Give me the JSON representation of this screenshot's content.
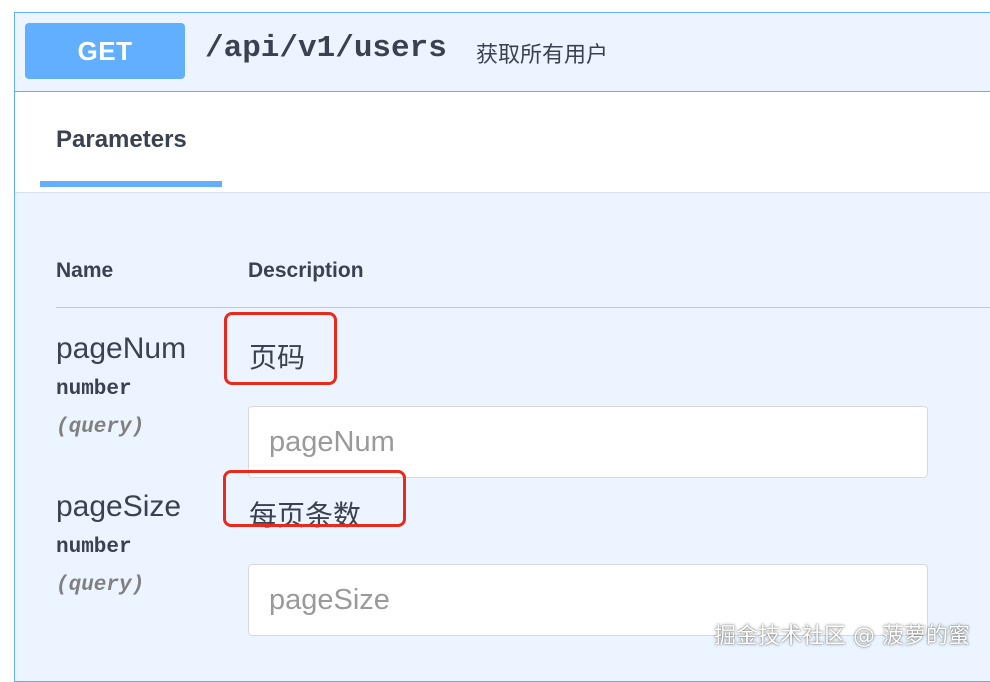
{
  "operation": {
    "method": "GET",
    "path": "/api/v1/users",
    "summary": "获取所有用户"
  },
  "tabs": [
    {
      "label": "Parameters",
      "active": true
    }
  ],
  "table": {
    "headers": {
      "name": "Name",
      "description": "Description"
    }
  },
  "parameters": [
    {
      "name": "pageNum",
      "type": "number",
      "in": "(query)",
      "description": "页码",
      "placeholder": "pageNum",
      "value": ""
    },
    {
      "name": "pageSize",
      "type": "number",
      "in": "(query)",
      "description": "每页条数",
      "placeholder": "pageSize",
      "value": ""
    }
  ],
  "watermark": "掘金技术社区 @ 菠萝的蜜",
  "colors": {
    "accent": "#61affe",
    "panel_bg": "#ecf5ff",
    "text": "#3b4151",
    "highlight": "#e8291c"
  }
}
